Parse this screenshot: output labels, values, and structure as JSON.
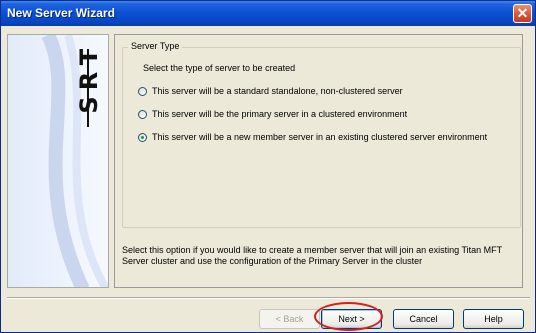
{
  "window": {
    "title": "New Server Wizard",
    "close_icon": "close-icon"
  },
  "side_panel": {
    "logo_letters": [
      "T",
      "R",
      "S"
    ]
  },
  "server_type": {
    "legend": "Server Type",
    "prompt": "Select the type of server to be created",
    "options": [
      {
        "label": "This server will be a standard standalone, non-clustered server",
        "selected": false
      },
      {
        "label": "This server will be the primary server in a clustered environment",
        "selected": false
      },
      {
        "label": "This server will be a new member server in an existing clustered server environment",
        "selected": true
      }
    ]
  },
  "description": "Select this option if you would like to create a member server that will join an existing Titan MFT Server cluster and use the configuration of the Primary Server in the cluster",
  "buttons": {
    "back": "< Back",
    "next": "Next >",
    "cancel": "Cancel",
    "help": "Help"
  },
  "colors": {
    "titlebar": "#0a4fd3",
    "dialog_bg": "#ece9d8",
    "highlight": "#d42020"
  }
}
